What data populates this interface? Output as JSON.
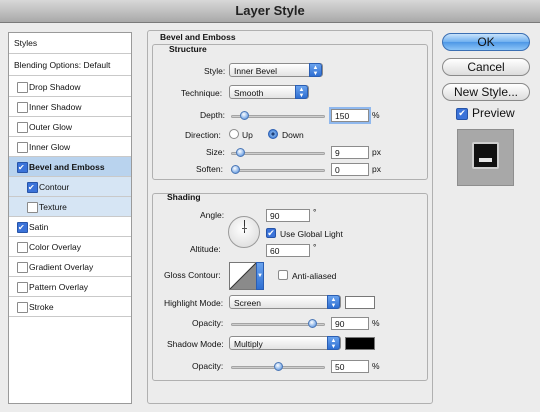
{
  "window": {
    "title": "Layer Style"
  },
  "sidebar": {
    "styles_label": "Styles",
    "blending_label": "Blending Options: Default",
    "items": [
      {
        "label": "Drop Shadow",
        "checked": false
      },
      {
        "label": "Inner Shadow",
        "checked": false
      },
      {
        "label": "Outer Glow",
        "checked": false
      },
      {
        "label": "Inner Glow",
        "checked": false
      },
      {
        "label": "Bevel and Emboss",
        "checked": true
      },
      {
        "label": "Contour",
        "checked": true
      },
      {
        "label": "Texture",
        "checked": false
      },
      {
        "label": "Satin",
        "checked": true
      },
      {
        "label": "Color Overlay",
        "checked": false
      },
      {
        "label": "Gradient Overlay",
        "checked": false
      },
      {
        "label": "Pattern Overlay",
        "checked": false
      },
      {
        "label": "Stroke",
        "checked": false
      }
    ]
  },
  "bevel": {
    "title": "Bevel and Emboss",
    "structure_title": "Structure",
    "style_label": "Style:",
    "style_value": "Inner Bevel",
    "technique_label": "Technique:",
    "technique_value": "Smooth",
    "depth_label": "Depth:",
    "depth_value": "150",
    "depth_level": 0.1,
    "percent": "%",
    "direction_label": "Direction:",
    "up_label": "Up",
    "down_label": "Down",
    "direction_selected": "Down",
    "size_label": "Size:",
    "size_value": "9",
    "size_level": 0.06,
    "px": "px",
    "soften_label": "Soften:",
    "soften_value": "0",
    "soften_level": 0.0
  },
  "shading": {
    "title": "Shading",
    "angle_label": "Angle:",
    "angle_value": "90",
    "degree": "°",
    "use_global_light_label": "Use Global Light",
    "use_global_light": true,
    "altitude_label": "Altitude:",
    "altitude_value": "60",
    "gloss_contour_label": "Gloss Contour:",
    "anti_aliased_label": "Anti-aliased",
    "anti_aliased": false,
    "highlight_mode_label": "Highlight Mode:",
    "highlight_mode_value": "Screen",
    "highlight_color": "#ffffff",
    "highlight_opacity_label": "Opacity:",
    "highlight_opacity_value": "90",
    "highlight_opacity_level": 0.9,
    "shadow_mode_label": "Shadow Mode:",
    "shadow_mode_value": "Multiply",
    "shadow_color": "#000000",
    "shadow_opacity_label": "Opacity:",
    "shadow_opacity_value": "50",
    "shadow_opacity_level": 0.5
  },
  "buttons": {
    "ok": "OK",
    "cancel": "Cancel",
    "new_style": "New Style...",
    "preview_label": "Preview",
    "preview_checked": true
  }
}
